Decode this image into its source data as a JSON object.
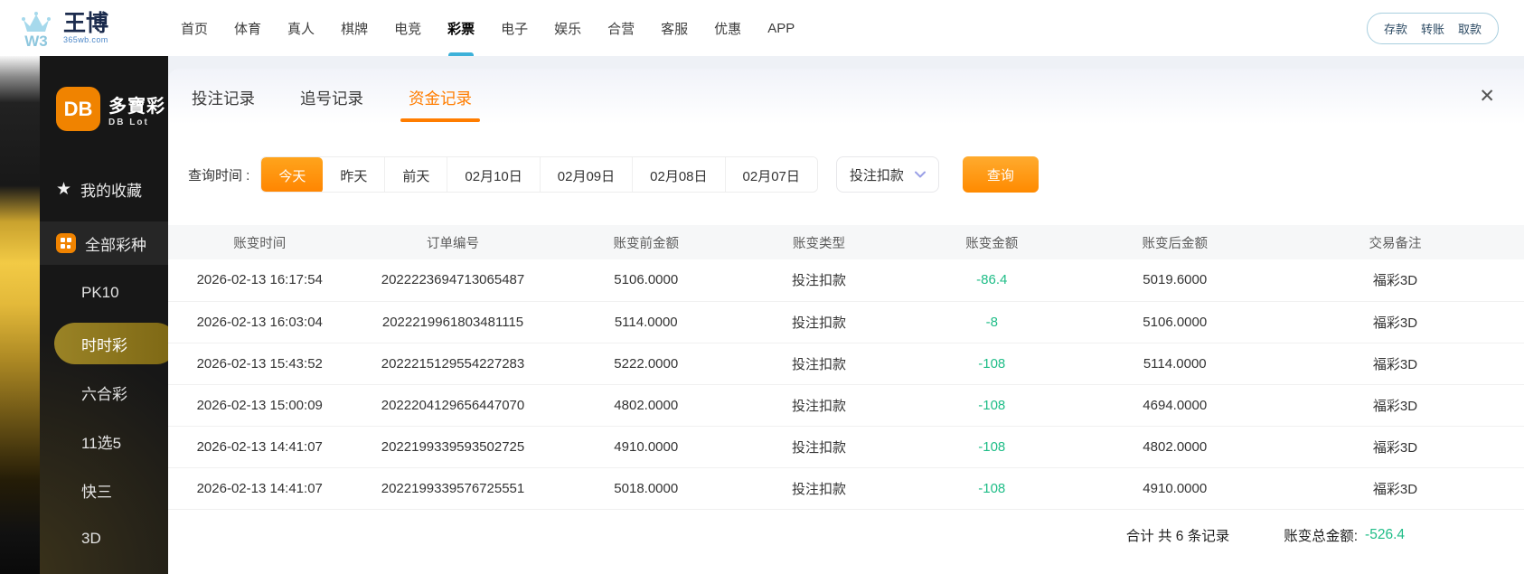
{
  "navbar": {
    "logo": {
      "mark": "W3",
      "brand": "王博",
      "domain": "365wb.com"
    },
    "items": [
      {
        "label": "首页"
      },
      {
        "label": "体育"
      },
      {
        "label": "真人"
      },
      {
        "label": "棋牌"
      },
      {
        "label": "电竞"
      },
      {
        "label": "彩票",
        "active": true
      },
      {
        "label": "电子"
      },
      {
        "label": "娱乐"
      },
      {
        "label": "合营"
      },
      {
        "label": "客服"
      },
      {
        "label": "优惠"
      },
      {
        "label": "APP"
      }
    ],
    "wallet_actions": [
      "存款",
      "转账",
      "取款"
    ]
  },
  "sidebar": {
    "logo": {
      "badge": "DB",
      "name": "多寶彩",
      "subname": "DB Lot"
    },
    "items": [
      {
        "label": "我的收藏",
        "icon": "star"
      },
      {
        "label": "全部彩种",
        "icon": "grid",
        "highlighted": true
      },
      {
        "label": "PK10"
      },
      {
        "label": "时时彩",
        "active": true
      },
      {
        "label": "六合彩"
      },
      {
        "label": "11选5"
      },
      {
        "label": "快三"
      },
      {
        "label": "3D"
      }
    ]
  },
  "panel": {
    "tabs": [
      {
        "label": "投注记录"
      },
      {
        "label": "追号记录"
      },
      {
        "label": "资金记录",
        "active": true
      }
    ],
    "close_icon": "✕",
    "filter": {
      "label": "查询时间 :",
      "date_options": [
        {
          "label": "今天",
          "active": true
        },
        {
          "label": "昨天"
        },
        {
          "label": "前天"
        },
        {
          "label": "02月10日"
        },
        {
          "label": "02月09日"
        },
        {
          "label": "02月08日"
        },
        {
          "label": "02月07日"
        }
      ],
      "type_selected": "投注扣款",
      "query_label": "查询"
    },
    "table": {
      "headers": [
        "账变时间",
        "订单编号",
        "账变前金额",
        "账变类型",
        "账变金额",
        "账变后金额",
        "交易备注"
      ],
      "rows": [
        {
          "time": "2026-02-13 16:17:54",
          "order": "2022223694713065487",
          "before": "5106.0000",
          "type": "投注扣款",
          "amount": "-86.4",
          "after": "5019.6000",
          "remark": "福彩3D"
        },
        {
          "time": "2026-02-13 16:03:04",
          "order": "2022219961803481115",
          "before": "5114.0000",
          "type": "投注扣款",
          "amount": "-8",
          "after": "5106.0000",
          "remark": "福彩3D"
        },
        {
          "time": "2026-02-13 15:43:52",
          "order": "2022215129554227283",
          "before": "5222.0000",
          "type": "投注扣款",
          "amount": "-108",
          "after": "5114.0000",
          "remark": "福彩3D"
        },
        {
          "time": "2026-02-13 15:00:09",
          "order": "2022204129656447070",
          "before": "4802.0000",
          "type": "投注扣款",
          "amount": "-108",
          "after": "4694.0000",
          "remark": "福彩3D"
        },
        {
          "time": "2026-02-13 14:41:07",
          "order": "2022199339593502725",
          "before": "4910.0000",
          "type": "投注扣款",
          "amount": "-108",
          "after": "4802.0000",
          "remark": "福彩3D"
        },
        {
          "time": "2026-02-13 14:41:07",
          "order": "2022199339576725551",
          "before": "5018.0000",
          "type": "投注扣款",
          "amount": "-108",
          "after": "4910.0000",
          "remark": "福彩3D"
        }
      ]
    },
    "footer": {
      "total_label": "合计 共 6 条记录",
      "amount_label": "账变总金额:",
      "amount_value": "-526.4"
    }
  },
  "colors": {
    "accent_orange": "#ff8a00",
    "negative_green": "#1fbd87",
    "nav_underline_blue": "#3db1d9",
    "sidebar_active_gold": "#8c751d",
    "db_logo_orange": "#f08300"
  }
}
